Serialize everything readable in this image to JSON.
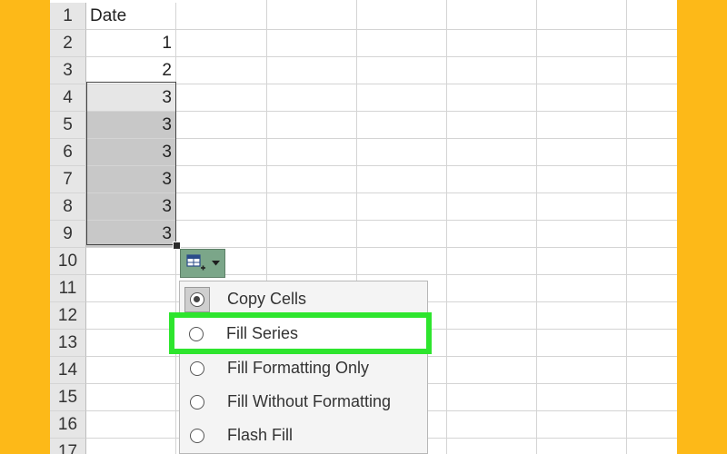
{
  "colors": {
    "frame": "#FDB918",
    "highlight": "#2ee52e",
    "autofill_button": "#7ba689"
  },
  "spreadsheet": {
    "header_cell": "Date",
    "row_numbers": [
      "1",
      "2",
      "3",
      "4",
      "5",
      "6",
      "7",
      "8",
      "9",
      "10",
      "11",
      "12",
      "13",
      "14",
      "15",
      "16",
      "17"
    ],
    "column_a_values": [
      "1",
      "2",
      "3",
      "3",
      "3",
      "3",
      "3",
      "3"
    ]
  },
  "autofill_options": {
    "button_icon": "autofill-options-icon",
    "dropdown_icon": "chevron-down-icon",
    "items": [
      {
        "label": "Copy Cells",
        "selected": true
      },
      {
        "label": "Fill Series",
        "selected": false
      },
      {
        "label": "Fill Formatting Only",
        "selected": false
      },
      {
        "label": "Fill Without Formatting",
        "selected": false
      },
      {
        "label": "Flash Fill",
        "selected": false
      }
    ]
  }
}
